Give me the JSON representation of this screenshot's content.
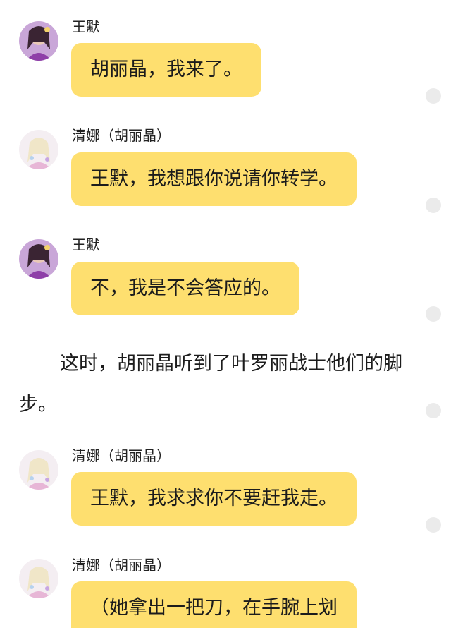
{
  "messages": [
    {
      "speaker": "王默",
      "text": "胡丽晶，我来了。"
    },
    {
      "speaker": "清娜（胡丽晶）",
      "text": "王默，我想跟你说请你转学。"
    },
    {
      "speaker": "王默",
      "text": "不，我是不会答应的。"
    },
    {
      "speaker": "清娜（胡丽晶）",
      "text": "王默，我求求你不要赶我走。"
    },
    {
      "speaker": "清娜（胡丽晶）",
      "text": "（她拿出一把刀，在手腕上划"
    }
  ],
  "narration": "这时，胡丽晶听到了叶罗丽战士他们的脚步。",
  "colors": {
    "bubble": "#fedf6f",
    "scroll_dot": "#ebebeb"
  }
}
